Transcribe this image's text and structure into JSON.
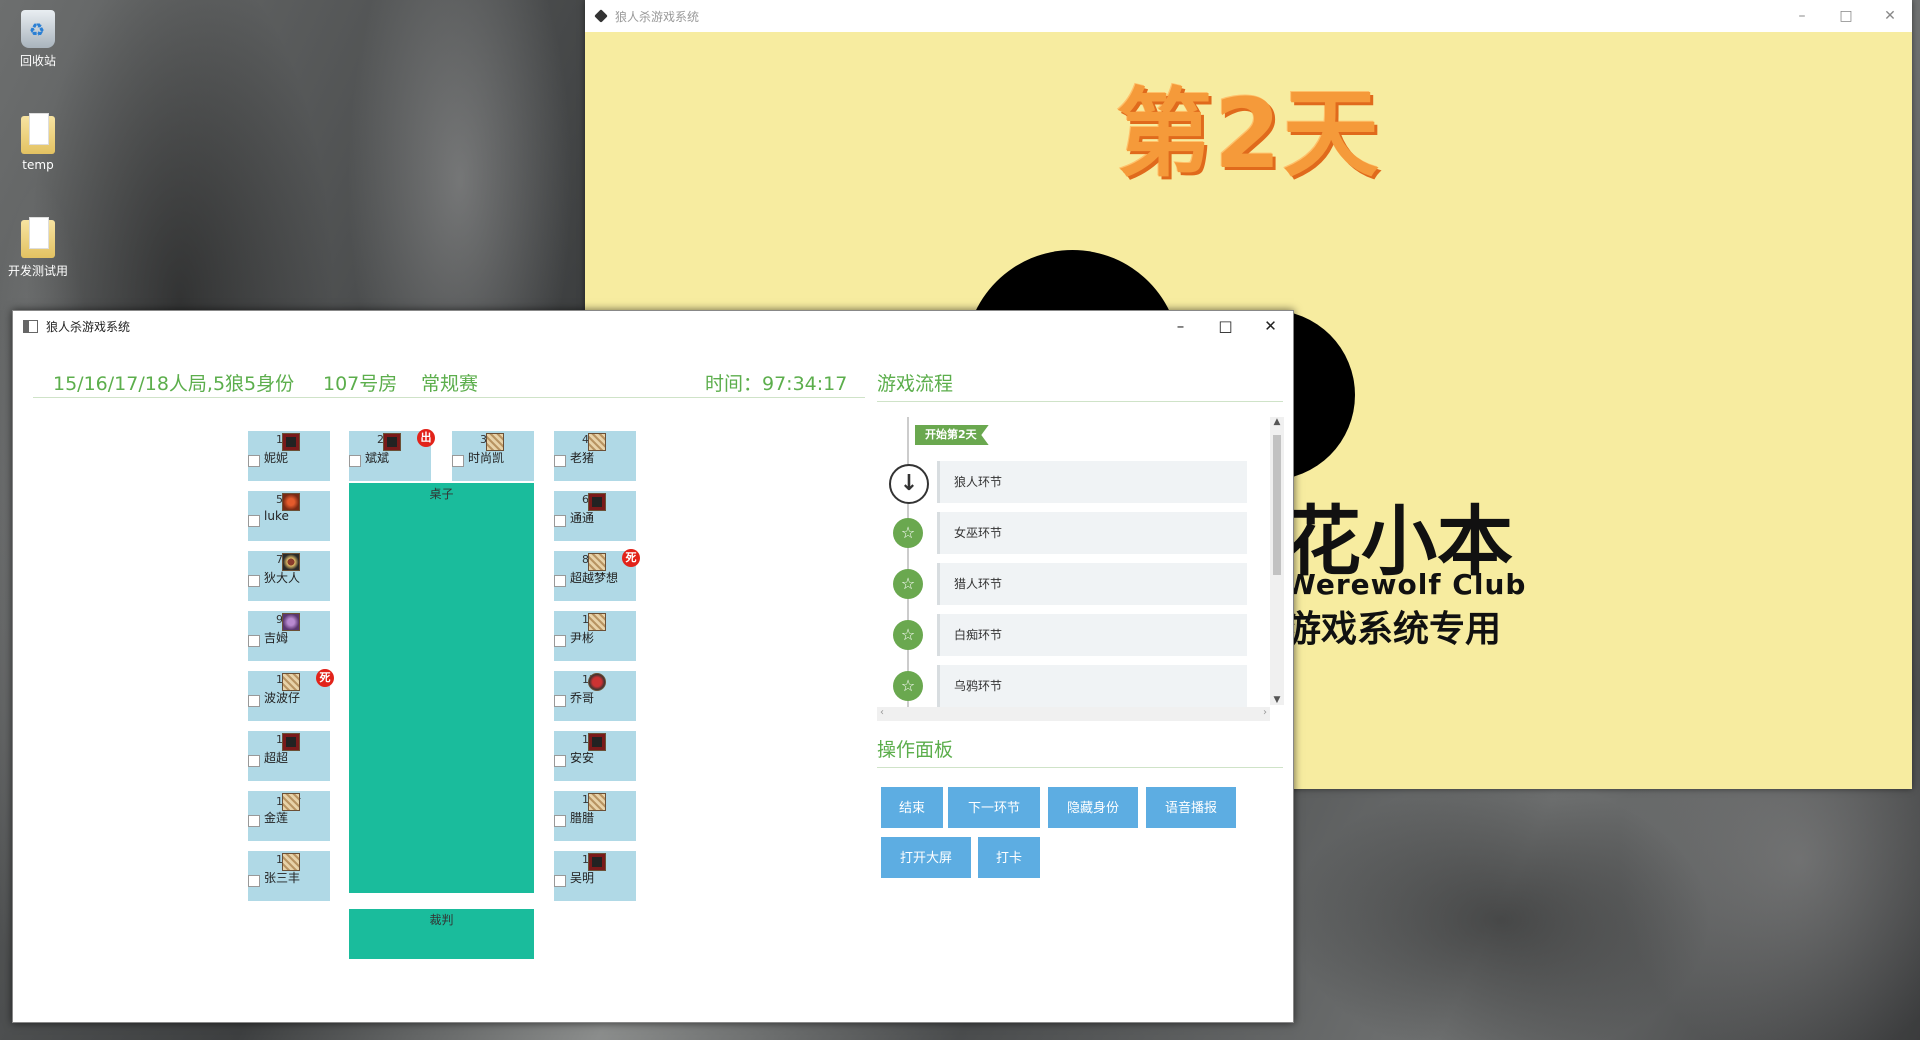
{
  "desktop": {
    "icons": [
      {
        "label": "回收站"
      },
      {
        "label": "temp"
      },
      {
        "label": "开发测试用"
      }
    ]
  },
  "big_screen": {
    "title": "狼人杀游戏系统",
    "day_title": "第2天",
    "logo_line1": "花小本",
    "logo_line2": "Werewolf Club",
    "logo_line3": "游戏系统专用"
  },
  "main": {
    "title": "狼人杀游戏系统",
    "header": {
      "game_mode": "15/16/17/18人局,5狼5身份",
      "room": "107号房",
      "match_type": "常规赛",
      "time": "时间：97:34:17"
    },
    "table_label": "桌子",
    "judge_label": "裁判",
    "seats": [
      {
        "num": "1",
        "name": "妮妮",
        "role": "wolf",
        "badge": ""
      },
      {
        "num": "2",
        "name": "斌斌",
        "role": "wolf",
        "badge": "出"
      },
      {
        "num": "3",
        "name": "时尚凯",
        "role": "civ",
        "badge": ""
      },
      {
        "num": "4",
        "name": "老猪",
        "role": "civ",
        "badge": ""
      },
      {
        "num": "5",
        "name": "luke",
        "role": "witch",
        "badge": ""
      },
      {
        "num": "6",
        "name": "通通",
        "role": "wolf",
        "badge": ""
      },
      {
        "num": "7",
        "name": "狄大人",
        "role": "seer",
        "badge": ""
      },
      {
        "num": "8",
        "name": "超越梦想",
        "role": "civ",
        "badge": "死"
      },
      {
        "num": "9",
        "name": "吉姆",
        "role": "idiot",
        "badge": ""
      },
      {
        "num": "10",
        "name": "尹彬",
        "role": "civ",
        "badge": ""
      },
      {
        "num": "11",
        "name": "波波仔",
        "role": "civ",
        "badge": "死"
      },
      {
        "num": "12",
        "name": "乔哥",
        "role": "hunter",
        "badge": ""
      },
      {
        "num": "13",
        "name": "超超",
        "role": "wolf",
        "badge": ""
      },
      {
        "num": "14",
        "name": "安安",
        "role": "wolf",
        "badge": ""
      },
      {
        "num": "15村",
        "name": "金莲",
        "role": "civ",
        "badge": ""
      },
      {
        "num": "16",
        "name": "腊腊",
        "role": "civ",
        "badge": ""
      },
      {
        "num": "17",
        "name": "张三丰",
        "role": "civ",
        "badge": ""
      },
      {
        "num": "18",
        "name": "吴明",
        "role": "wolf",
        "badge": ""
      }
    ],
    "flow": {
      "heading": "游戏流程",
      "banner": "开始第2天",
      "steps": [
        "狼人环节",
        "女巫环节",
        "猎人环节",
        "白痴环节",
        "乌鸦环节"
      ]
    },
    "ops": {
      "heading": "操作面板",
      "buttons": [
        "结束",
        "下一环节",
        "隐藏身份",
        "语音播报",
        "打开大屏",
        "打卡"
      ]
    }
  },
  "colors": {
    "accent_green": "#5cae4c",
    "seat_bg": "#b0d9e6",
    "table_bg": "#1abc9c",
    "button_bg": "#5dade2",
    "big_screen_bg": "#f7eca0"
  }
}
